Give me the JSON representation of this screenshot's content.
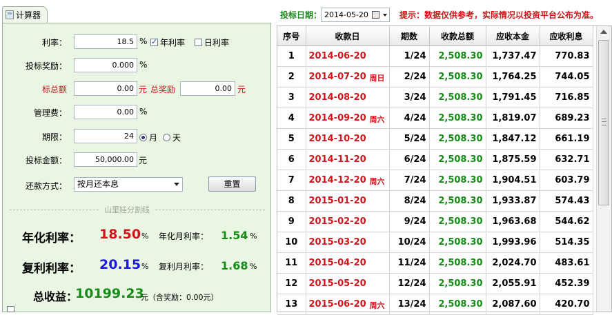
{
  "tab": {
    "title": "计算器"
  },
  "form": {
    "rate_label": "利率：",
    "rate_value": "18.5",
    "rate_unit": "%",
    "annual_rate_label": "年利率",
    "annual_rate_checked": true,
    "daily_rate_label": "日利率",
    "daily_rate_checked": false,
    "bonus_label": "投标奖励：",
    "bonus_value": "0.000",
    "bonus_unit": "%",
    "total_label": "标总额",
    "total_value": "0.00",
    "total_unit": "元",
    "total_bonus_label": "总奖励",
    "total_bonus_value": "0.00",
    "total_bonus_unit": "元",
    "mgmt_fee_label": "管理费：",
    "mgmt_fee_value": "0.00",
    "mgmt_fee_unit": "%",
    "term_label": "期限：",
    "term_value": "24",
    "term_month_label": "月",
    "term_month_selected": true,
    "term_day_label": "天",
    "term_day_selected": false,
    "amount_label": "投标金额：",
    "amount_value": "50,000.00",
    "amount_unit": "元",
    "method_label": "还款方式：",
    "method_value": "按月还本息",
    "reset_label": "重置"
  },
  "divider_text": "山里娃分割线",
  "results": {
    "annual_label": "年化利率：",
    "annual_value": "18.50",
    "annual_unit": "%",
    "annual_month_label": "年化月利率：",
    "annual_month_value": "1.54",
    "annual_month_unit": "%",
    "compound_label": "复利利率：",
    "compound_value": "20.15",
    "compound_unit": "%",
    "compound_month_label": "复利月利率：",
    "compound_month_value": "1.68",
    "compound_month_unit": "%",
    "total_income_label": "总收益：",
    "total_income_value": "10199.23",
    "total_income_unit": "元（含奖励：0.00元）"
  },
  "top": {
    "date_label": "投标日期：",
    "date_value": "2014-05-20",
    "hint": "提示：数据仅供参考，实际情况以投资平台公布为准。"
  },
  "table": {
    "headers": [
      "序号",
      "收款日",
      "期数",
      "收款总额",
      "应收本金",
      "应收利息"
    ],
    "rows": [
      {
        "idx": "1",
        "date": "2014-06-20",
        "weekday": "",
        "period": "1/24",
        "total": "2,508.30",
        "principal": "1,737.47",
        "interest": "770.83"
      },
      {
        "idx": "2",
        "date": "2014-07-20",
        "weekday": "周日",
        "period": "2/24",
        "total": "2,508.30",
        "principal": "1,764.25",
        "interest": "744.05"
      },
      {
        "idx": "3",
        "date": "2014-08-20",
        "weekday": "",
        "period": "3/24",
        "total": "2,508.30",
        "principal": "1,791.45",
        "interest": "716.85"
      },
      {
        "idx": "4",
        "date": "2014-09-20",
        "weekday": "周六",
        "period": "4/24",
        "total": "2,508.30",
        "principal": "1,819.07",
        "interest": "689.23"
      },
      {
        "idx": "5",
        "date": "2014-10-20",
        "weekday": "",
        "period": "5/24",
        "total": "2,508.30",
        "principal": "1,847.12",
        "interest": "661.19"
      },
      {
        "idx": "6",
        "date": "2014-11-20",
        "weekday": "",
        "period": "6/24",
        "total": "2,508.30",
        "principal": "1,875.59",
        "interest": "632.71"
      },
      {
        "idx": "7",
        "date": "2014-12-20",
        "weekday": "周六",
        "period": "7/24",
        "total": "2,508.30",
        "principal": "1,904.51",
        "interest": "603.79"
      },
      {
        "idx": "8",
        "date": "2015-01-20",
        "weekday": "",
        "period": "8/24",
        "total": "2,508.30",
        "principal": "1,933.87",
        "interest": "574.43"
      },
      {
        "idx": "9",
        "date": "2015-02-20",
        "weekday": "",
        "period": "9/24",
        "total": "2,508.30",
        "principal": "1,963.68",
        "interest": "544.62"
      },
      {
        "idx": "10",
        "date": "2015-03-20",
        "weekday": "",
        "period": "10/24",
        "total": "2,508.30",
        "principal": "1,993.96",
        "interest": "514.35"
      },
      {
        "idx": "11",
        "date": "2015-04-20",
        "weekday": "",
        "period": "11/24",
        "total": "2,508.30",
        "principal": "2,024.70",
        "interest": "483.61"
      },
      {
        "idx": "12",
        "date": "2015-05-20",
        "weekday": "",
        "period": "12/24",
        "total": "2,508.30",
        "principal": "2,055.91",
        "interest": "452.39"
      },
      {
        "idx": "13",
        "date": "2015-06-20",
        "weekday": "周六",
        "period": "13/24",
        "total": "2,508.30",
        "principal": "2,087.60",
        "interest": "420.70"
      }
    ]
  },
  "colors": {
    "panel_bg": "#eaf6e4",
    "red": "#d0141a",
    "green": "#178a17",
    "blue": "#1a1ad8"
  }
}
